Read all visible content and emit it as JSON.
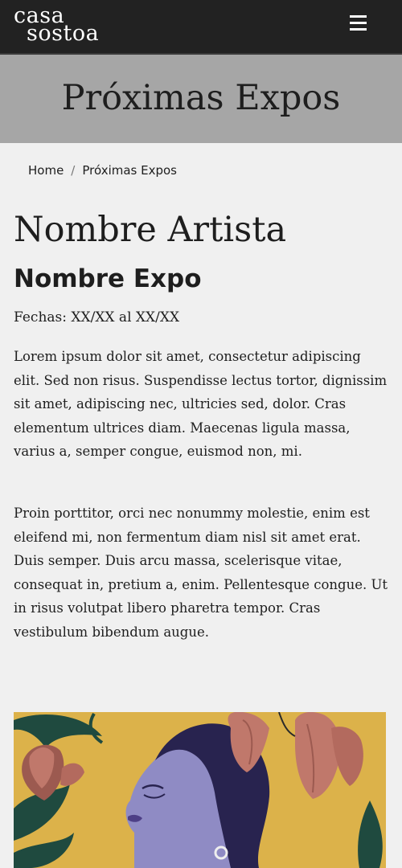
{
  "header": {
    "logo_line1": "casa",
    "logo_line2": "sostoa",
    "menu_icon": "hamburger-menu-icon"
  },
  "hero": {
    "title": "Próximas Expos"
  },
  "breadcrumb": {
    "home": "Home",
    "separator": "/",
    "current": "Próximas Expos"
  },
  "expo": {
    "artist": "Nombre Artista",
    "name": "Nombre Expo",
    "dates": "Fechas: XX/XX al XX/XX",
    "paragraphs": [
      "Lorem ipsum dolor sit amet, consectetur adipiscing elit. Sed non risus. Suspendisse lectus tortor, dignissim sit amet, adipiscing nec, ultricies sed, dolor. Cras elementum ultrices diam. Maecenas ligula massa, varius a, semper congue, euismod non, mi.",
      "Proin porttitor, orci nec nonummy molestie, enim est eleifend mi, non fermentum diam nisl sit amet erat. Duis semper. Duis arcu massa, scelerisque vitae, consequat in, pretium a, enim. Pellentesque congue. Ut in risus volutpat libero pharetra tempor. Cras vestibulum bibendum augue."
    ]
  },
  "colors": {
    "topbar": "#222222",
    "hero_band": "#a6a6a6",
    "page_bg": "#f0f0f0",
    "text": "#1e1e1e",
    "art_yellow": "#dcb24a",
    "art_face": "#8f8bc4",
    "art_hair": "#28234f",
    "art_flower": "#c0786b",
    "art_leaf": "#1f4a3f"
  }
}
